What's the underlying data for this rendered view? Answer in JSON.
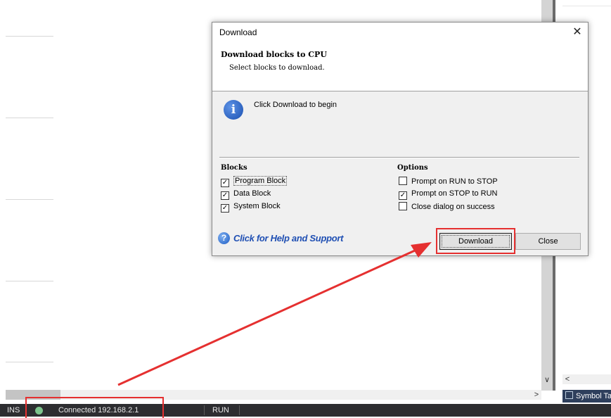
{
  "dialog": {
    "title": "Download",
    "close_glyph": "✕",
    "header_title": "Download blocks to CPU",
    "header_subtitle": "Select blocks to download.",
    "info_icon": "info-icon",
    "info_message": "Click Download to begin",
    "blocks": {
      "title": "Blocks",
      "items": [
        {
          "label": "Program Block",
          "checked": true
        },
        {
          "label": "Data Block",
          "checked": true
        },
        {
          "label": "System Block",
          "checked": true
        }
      ]
    },
    "options": {
      "title": "Options",
      "items": [
        {
          "label": "Prompt on RUN to STOP",
          "checked": false
        },
        {
          "label": "Prompt on STOP to RUN",
          "checked": true
        },
        {
          "label": "Close dialog on success",
          "checked": false
        }
      ]
    },
    "help_link": "Click for Help and Support",
    "download_button": "Download",
    "close_button": "Close"
  },
  "statusbar": {
    "mode": "INS",
    "connection": "Connected 192.168.2.1",
    "state": "RUN",
    "connection_color": "#7dc48c"
  },
  "right_panel": {
    "tab_label": "Symbol Table"
  },
  "annotations": {
    "color": "#e53030"
  }
}
